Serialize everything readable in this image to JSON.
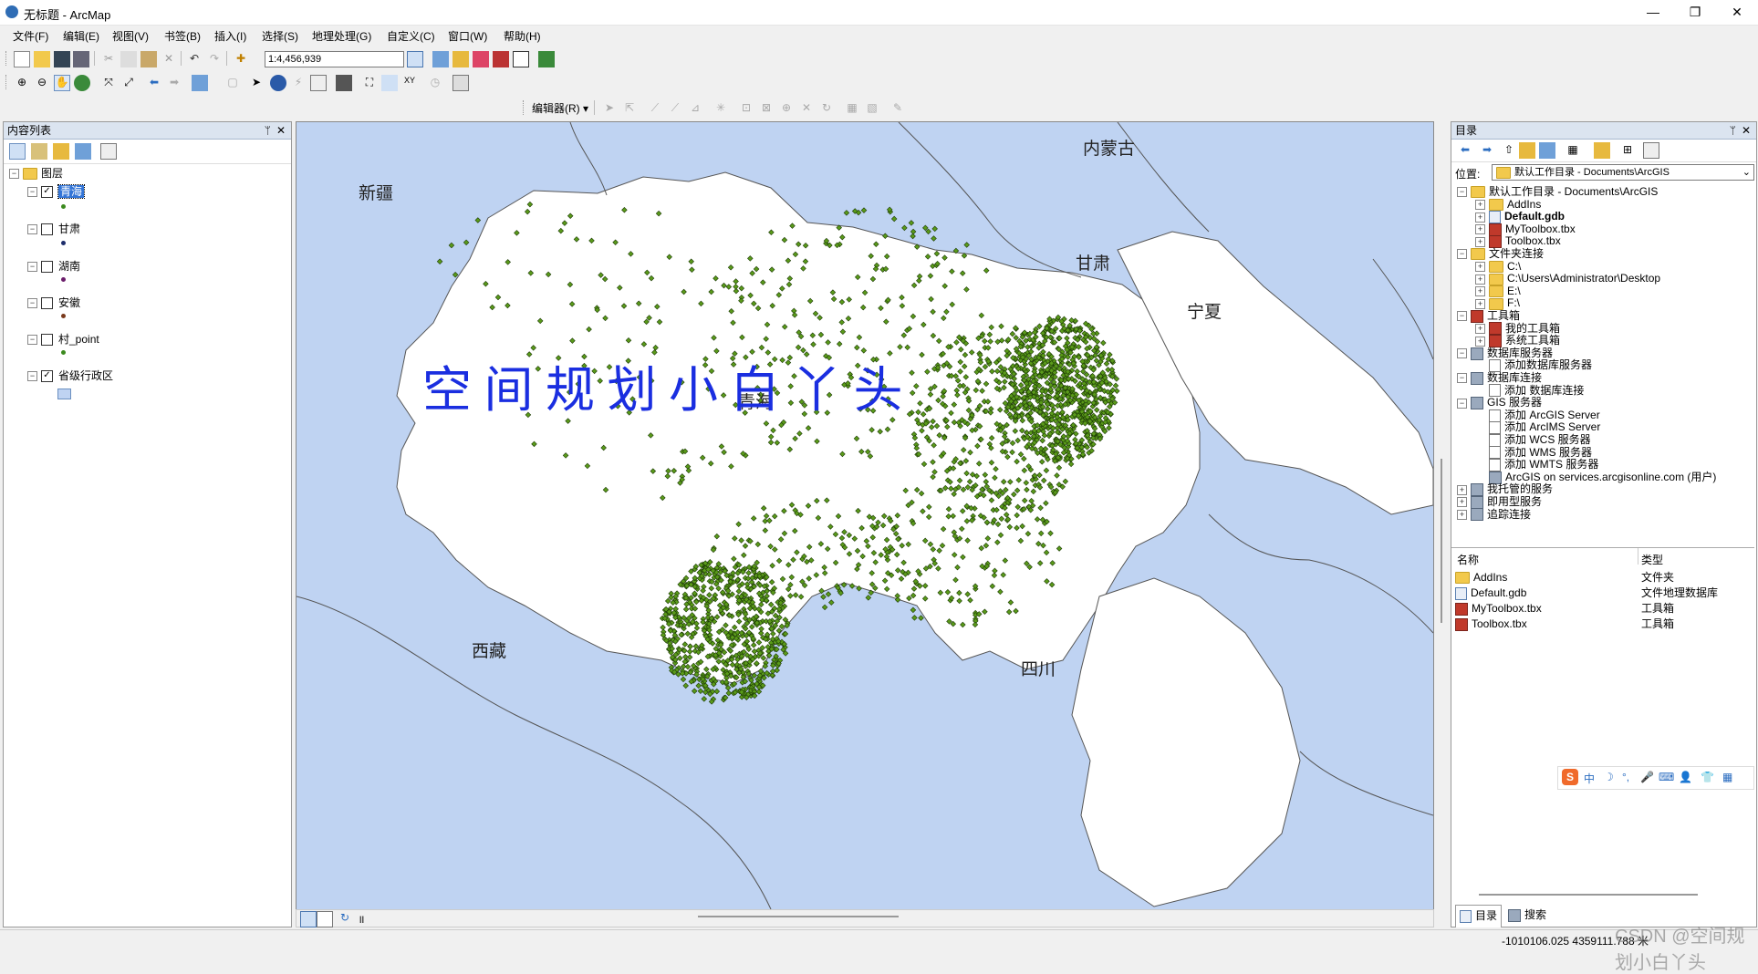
{
  "window": {
    "title": "无标题 - ArcMap",
    "minimize": "—",
    "maximize": "❐",
    "close": "✕"
  },
  "menu": [
    "文件(F)",
    "编辑(E)",
    "视图(V)",
    "书签(B)",
    "插入(I)",
    "选择(S)",
    "地理处理(G)",
    "自定义(C)",
    "窗口(W)",
    "帮助(H)"
  ],
  "toolbar": {
    "scale": "1:4,456,939",
    "editor_label": "编辑器(R) ▾"
  },
  "toc": {
    "header": "内容列表",
    "root": "图层",
    "layers": [
      {
        "name": "青海",
        "checked": true,
        "selected": true
      },
      {
        "name": "甘肃",
        "checked": false
      },
      {
        "name": "湖南",
        "checked": false
      },
      {
        "name": "安徽",
        "checked": false
      },
      {
        "name": "村_point",
        "checked": false
      },
      {
        "name": "省级行政区",
        "checked": true
      }
    ]
  },
  "map": {
    "labels": {
      "xinjiang": "新疆",
      "neimenggu": "内蒙古",
      "gansu": "甘肃",
      "ningxia": "宁夏",
      "qinghai": "青海",
      "xizang": "西藏",
      "sichuan": "四川"
    },
    "watermark": "空 间 规 划 小 白 丫 头",
    "background_color": "#bfd3f2",
    "land_color": "#ffffff",
    "point_color": "#5a9a1a"
  },
  "catalog": {
    "header": "目录",
    "location_label": "位置:",
    "location_value": "默认工作目录 - Documents\\ArcGIS",
    "tree": [
      {
        "label": "默认工作目录 - Documents\\ArcGIS",
        "level": 0,
        "icon": "folder-icon",
        "pm": "−"
      },
      {
        "label": "AddIns",
        "level": 1,
        "icon": "folder-icon",
        "pm": "+"
      },
      {
        "label": "Default.gdb",
        "level": 1,
        "icon": "geodatabase-icon",
        "pm": "+",
        "bold": true
      },
      {
        "label": "MyToolbox.tbx",
        "level": 1,
        "icon": "toolbox-icon",
        "pm": "+"
      },
      {
        "label": "Toolbox.tbx",
        "level": 1,
        "icon": "toolbox-icon",
        "pm": "+"
      },
      {
        "label": "文件夹连接",
        "level": 0,
        "icon": "folder-icon",
        "pm": "−"
      },
      {
        "label": "C:\\",
        "level": 1,
        "icon": "folder-icon",
        "pm": "+"
      },
      {
        "label": "C:\\Users\\Administrator\\Desktop",
        "level": 1,
        "icon": "folder-icon",
        "pm": "+"
      },
      {
        "label": "E:\\",
        "level": 1,
        "icon": "folder-icon",
        "pm": "+"
      },
      {
        "label": "F:\\",
        "level": 1,
        "icon": "folder-icon",
        "pm": "+"
      },
      {
        "label": "工具箱",
        "level": 0,
        "icon": "toolbox-icon",
        "pm": "−"
      },
      {
        "label": "我的工具箱",
        "level": 1,
        "icon": "toolbox-icon",
        "pm": "+"
      },
      {
        "label": "系统工具箱",
        "level": 1,
        "icon": "toolbox-icon",
        "pm": "+"
      },
      {
        "label": "数据库服务器",
        "level": 0,
        "icon": "server-icon",
        "pm": "−"
      },
      {
        "label": "添加数据库服务器",
        "level": 1,
        "icon": "add-icon",
        "pm": ""
      },
      {
        "label": "数据库连接",
        "level": 0,
        "icon": "server-icon",
        "pm": "−"
      },
      {
        "label": "添加 数据库连接",
        "level": 1,
        "icon": "add-icon",
        "pm": ""
      },
      {
        "label": "GIS 服务器",
        "level": 0,
        "icon": "server-icon",
        "pm": "−"
      },
      {
        "label": "添加 ArcGIS Server",
        "level": 1,
        "icon": "add-icon",
        "pm": ""
      },
      {
        "label": "添加 ArcIMS Server",
        "level": 1,
        "icon": "add-icon",
        "pm": ""
      },
      {
        "label": "添加 WCS 服务器",
        "level": 1,
        "icon": "add-icon",
        "pm": ""
      },
      {
        "label": "添加 WMS 服务器",
        "level": 1,
        "icon": "add-icon",
        "pm": ""
      },
      {
        "label": "添加 WMTS 服务器",
        "level": 1,
        "icon": "add-icon",
        "pm": ""
      },
      {
        "label": "ArcGIS on services.arcgisonline.com (用户)",
        "level": 1,
        "icon": "server-icon",
        "pm": ""
      },
      {
        "label": "我托管的服务",
        "level": 0,
        "icon": "server-icon",
        "pm": "+"
      },
      {
        "label": "即用型服务",
        "level": 0,
        "icon": "server-icon",
        "pm": "+"
      },
      {
        "label": "追踪连接",
        "level": 0,
        "icon": "server-icon",
        "pm": "+"
      }
    ],
    "list_headers": {
      "name": "名称",
      "type": "类型"
    },
    "list": [
      {
        "name": "AddIns",
        "type": "文件夹",
        "icon": "folder-icon"
      },
      {
        "name": "Default.gdb",
        "type": "文件地理数据库",
        "icon": "geodatabase-icon"
      },
      {
        "name": "MyToolbox.tbx",
        "type": "工具箱",
        "icon": "toolbox-icon"
      },
      {
        "name": "Toolbox.tbx",
        "type": "工具箱",
        "icon": "toolbox-icon"
      }
    ],
    "tabs": [
      "目录",
      "搜索"
    ]
  },
  "ime": {
    "labels": [
      "中",
      "☽",
      "°,",
      "🎤",
      "⌨",
      "👤",
      "👕",
      "▦"
    ]
  },
  "status": {
    "coords": "-1010106.025  4359111.788 米",
    "credit": "CSDN @空间规划小白丫头"
  }
}
